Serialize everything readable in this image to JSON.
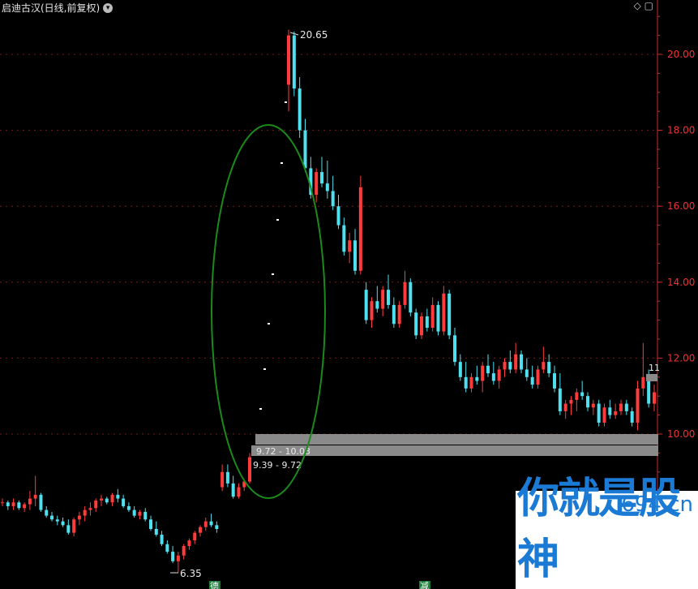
{
  "header": {
    "title": "启迪古汉(日线,前复权)",
    "dropdown_icon": "chevron-down-icon",
    "tools": "◇ ▢"
  },
  "watermark": {
    "site": "694.cn",
    "slogan": "你就是股神"
  },
  "chart_data": {
    "type": "candlestick",
    "ylim": [
      8.8,
      21.3
    ],
    "yticks": [
      10.0,
      12.0,
      14.0,
      16.0,
      18.0,
      20.0
    ],
    "ytick_labels": [
      "10.00",
      "12.00",
      "14.00",
      "16.00",
      "18.00",
      "20.00"
    ],
    "grid": true,
    "colors": {
      "up": "#ff3b3b",
      "down": "#4fe0f0",
      "axis": "#cc2a2a",
      "grid": "#7a1a1a",
      "ellipse": "#1a8a1a",
      "gap_box": "#8a8a8a"
    },
    "candles": [
      [
        8.2,
        8.3,
        8.1,
        8.2
      ],
      [
        8.2,
        8.25,
        8.0,
        8.1
      ],
      [
        8.1,
        8.3,
        8.0,
        8.2
      ],
      [
        8.2,
        8.25,
        8.0,
        8.05
      ],
      [
        8.05,
        8.2,
        7.95,
        8.15
      ],
      [
        8.15,
        8.5,
        8.0,
        8.3
      ],
      [
        8.3,
        8.9,
        8.1,
        8.4
      ],
      [
        8.4,
        8.45,
        7.95,
        8.0
      ],
      [
        8.0,
        8.1,
        7.8,
        7.85
      ],
      [
        7.85,
        7.95,
        7.7,
        7.75
      ],
      [
        7.75,
        7.85,
        7.6,
        7.7
      ],
      [
        7.7,
        7.8,
        7.55,
        7.6
      ],
      [
        7.6,
        7.75,
        7.35,
        7.4
      ],
      [
        7.4,
        7.8,
        7.3,
        7.75
      ],
      [
        7.75,
        7.95,
        7.6,
        7.85
      ],
      [
        7.85,
        8.1,
        7.7,
        8.0
      ],
      [
        8.0,
        8.2,
        7.85,
        8.05
      ],
      [
        8.05,
        8.3,
        7.95,
        8.25
      ],
      [
        8.25,
        8.4,
        8.1,
        8.3
      ],
      [
        8.3,
        8.35,
        8.15,
        8.2
      ],
      [
        8.2,
        8.45,
        8.1,
        8.4
      ],
      [
        8.4,
        8.55,
        8.2,
        8.3
      ],
      [
        8.3,
        8.4,
        8.05,
        8.1
      ],
      [
        8.1,
        8.2,
        7.95,
        8.0
      ],
      [
        8.0,
        8.1,
        7.8,
        7.85
      ],
      [
        7.85,
        8.0,
        7.75,
        7.95
      ],
      [
        7.95,
        8.05,
        7.7,
        7.75
      ],
      [
        7.75,
        7.85,
        7.45,
        7.5
      ],
      [
        7.5,
        7.7,
        7.3,
        7.35
      ],
      [
        7.35,
        7.45,
        7.05,
        7.1
      ],
      [
        7.1,
        7.2,
        6.85,
        6.9
      ],
      [
        6.9,
        7.05,
        6.6,
        6.65
      ],
      [
        6.65,
        6.9,
        6.35,
        6.8
      ],
      [
        6.8,
        7.1,
        6.7,
        7.05
      ],
      [
        7.05,
        7.25,
        6.95,
        7.2
      ],
      [
        7.2,
        7.45,
        7.1,
        7.4
      ],
      [
        7.4,
        7.6,
        7.3,
        7.55
      ],
      [
        7.55,
        7.8,
        7.45,
        7.7
      ],
      [
        7.7,
        7.9,
        7.55,
        7.6
      ],
      [
        7.6,
        7.7,
        7.4,
        7.5
      ],
      [
        8.6,
        9.2,
        8.5,
        9.0
      ],
      [
        9.0,
        9.2,
        8.6,
        8.7
      ],
      [
        8.7,
        8.9,
        8.3,
        8.35
      ],
      [
        8.35,
        8.7,
        8.3,
        8.6
      ],
      [
        8.6,
        8.8,
        8.5,
        8.75
      ],
      [
        8.75,
        9.5,
        8.7,
        9.39
      ],
      [
        19.2,
        20.65,
        18.5,
        20.5
      ],
      [
        20.5,
        20.6,
        18.9,
        19.1
      ],
      [
        19.1,
        19.4,
        17.8,
        18.0
      ],
      [
        18.0,
        18.3,
        16.9,
        17.0
      ],
      [
        17.0,
        17.3,
        16.2,
        16.3
      ],
      [
        16.3,
        17.0,
        16.1,
        16.9
      ],
      [
        16.9,
        17.3,
        16.5,
        16.6
      ],
      [
        16.6,
        17.2,
        16.2,
        16.4
      ],
      [
        16.4,
        16.8,
        15.9,
        16.0
      ],
      [
        16.0,
        16.3,
        15.4,
        15.5
      ],
      [
        15.5,
        15.7,
        14.7,
        14.8
      ],
      [
        14.8,
        15.3,
        14.5,
        15.1
      ],
      [
        15.1,
        15.4,
        14.2,
        14.3
      ],
      [
        14.3,
        16.8,
        14.2,
        16.5
      ],
      [
        13.8,
        14.0,
        12.9,
        13.0
      ],
      [
        13.0,
        13.6,
        12.8,
        13.5
      ],
      [
        13.5,
        13.9,
        13.2,
        13.3
      ],
      [
        13.3,
        13.9,
        13.1,
        13.8
      ],
      [
        13.8,
        14.2,
        13.3,
        13.4
      ],
      [
        13.4,
        13.6,
        12.8,
        12.9
      ],
      [
        12.9,
        13.5,
        12.8,
        13.4
      ],
      [
        13.4,
        14.3,
        13.3,
        14.0
      ],
      [
        14.0,
        14.1,
        13.1,
        13.2
      ],
      [
        13.2,
        13.3,
        12.5,
        12.6
      ],
      [
        12.6,
        13.2,
        12.5,
        13.1
      ],
      [
        13.1,
        13.3,
        12.7,
        12.8
      ],
      [
        12.8,
        13.6,
        12.7,
        13.4
      ],
      [
        13.4,
        13.5,
        12.6,
        12.7
      ],
      [
        12.7,
        13.9,
        12.6,
        13.7
      ],
      [
        13.7,
        13.8,
        12.5,
        12.6
      ],
      [
        12.6,
        12.8,
        11.8,
        11.9
      ],
      [
        11.9,
        12.1,
        11.4,
        11.5
      ],
      [
        11.5,
        11.9,
        11.1,
        11.2
      ],
      [
        11.2,
        11.6,
        11.1,
        11.5
      ],
      [
        11.5,
        11.8,
        11.3,
        11.4
      ],
      [
        11.4,
        11.9,
        11.1,
        11.8
      ],
      [
        11.8,
        12.1,
        11.5,
        11.6
      ],
      [
        11.6,
        11.9,
        11.3,
        11.4
      ],
      [
        11.4,
        11.8,
        11.2,
        11.7
      ],
      [
        11.7,
        12.0,
        11.5,
        11.9
      ],
      [
        11.9,
        12.2,
        11.6,
        11.7
      ],
      [
        11.7,
        12.4,
        11.6,
        12.1
      ],
      [
        12.1,
        12.2,
        11.6,
        11.7
      ],
      [
        11.7,
        12.0,
        11.4,
        11.5
      ],
      [
        11.5,
        11.8,
        11.2,
        11.3
      ],
      [
        11.3,
        11.8,
        11.2,
        11.7
      ],
      [
        11.7,
        12.3,
        11.6,
        11.9
      ],
      [
        11.9,
        12.1,
        11.5,
        11.6
      ],
      [
        11.6,
        11.8,
        11.1,
        11.2
      ],
      [
        11.2,
        11.6,
        10.5,
        10.6
      ],
      [
        10.6,
        10.9,
        10.4,
        10.8
      ],
      [
        10.8,
        11.0,
        10.5,
        10.9
      ],
      [
        10.9,
        11.2,
        10.6,
        11.1
      ],
      [
        11.1,
        11.4,
        10.9,
        11.0
      ],
      [
        11.0,
        11.1,
        10.6,
        10.7
      ],
      [
        10.7,
        10.9,
        10.5,
        10.8
      ],
      [
        10.8,
        10.9,
        10.2,
        10.3
      ],
      [
        10.3,
        10.8,
        10.2,
        10.7
      ],
      [
        10.7,
        10.9,
        10.4,
        10.5
      ],
      [
        10.5,
        10.8,
        10.4,
        10.6
      ],
      [
        10.6,
        10.9,
        10.5,
        10.8
      ],
      [
        10.8,
        10.9,
        10.5,
        10.6
      ],
      [
        10.6,
        10.7,
        10.2,
        10.3
      ],
      [
        10.3,
        11.4,
        10.1,
        11.2
      ],
      [
        11.2,
        12.4,
        11.0,
        11.5
      ],
      [
        11.5,
        11.7,
        10.7,
        10.8
      ],
      [
        10.8,
        11.3,
        10.6,
        11.1
      ]
    ],
    "gaps": [
      {
        "label": "9.72 - 10.03",
        "low": 9.72,
        "high": 10.03
      },
      {
        "label": "9.39 - 9.72",
        "low": 9.39,
        "high": 9.72
      }
    ],
    "annotations": {
      "high": {
        "label": "20.65",
        "value": 20.65
      },
      "low": {
        "label": "6.35",
        "value": 6.35
      },
      "last_partial": "11"
    },
    "bottom_markers": [
      "德",
      "减"
    ]
  }
}
